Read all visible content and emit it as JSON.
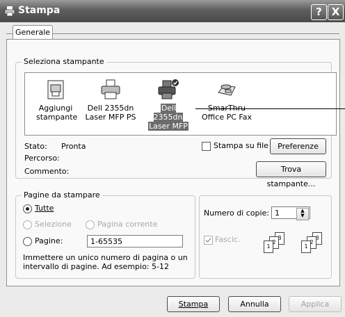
{
  "window": {
    "title": "Stampa",
    "help_icon": "?",
    "close_icon": "X"
  },
  "tabs": [
    {
      "label": "Generale"
    }
  ],
  "select_printer": {
    "group_label": "Seleziona stampante",
    "printers": [
      {
        "label_1": "Aggiungi",
        "label_2": "stampante",
        "icon": "add-printer-icon",
        "selected": false
      },
      {
        "label_1": "Dell 2355dn",
        "label_2": "Laser MFP PS",
        "icon": "printer-icon",
        "selected": false
      },
      {
        "label_1": "Dell 2355dn",
        "label_2": "Laser MFP",
        "icon": "default-printer-icon",
        "selected": true
      },
      {
        "label_1": "SmarThru",
        "label_2": "Office PC Fax",
        "icon": "fax-icon",
        "selected": false
      }
    ],
    "status_label": "Stato:",
    "status_value": "Pronta",
    "path_label": "Percorso:",
    "comment_label": "Commento:",
    "print_to_file_label": "Stampa su file",
    "preferences_button": "Preferenze",
    "find_printer_button": "Trova stampante..."
  },
  "page_range": {
    "group_label": "Pagine da stampare",
    "all_label": "Tutte",
    "selection_label": "Selezione",
    "current_page_label": "Pagina corrente",
    "pages_label": "Pagine:",
    "pages_value": "1-65535",
    "hint": "Immettere un unico numero di pagina o un intervallo di pagine. Ad esempio: 5-12"
  },
  "copies": {
    "label": "Numero di copie:",
    "value": "1",
    "collate_label": "Fascic.",
    "collate_checked": true
  },
  "footer": {
    "print_button": "Stampa",
    "cancel_button": "Annulla",
    "apply_button": "Applica"
  }
}
